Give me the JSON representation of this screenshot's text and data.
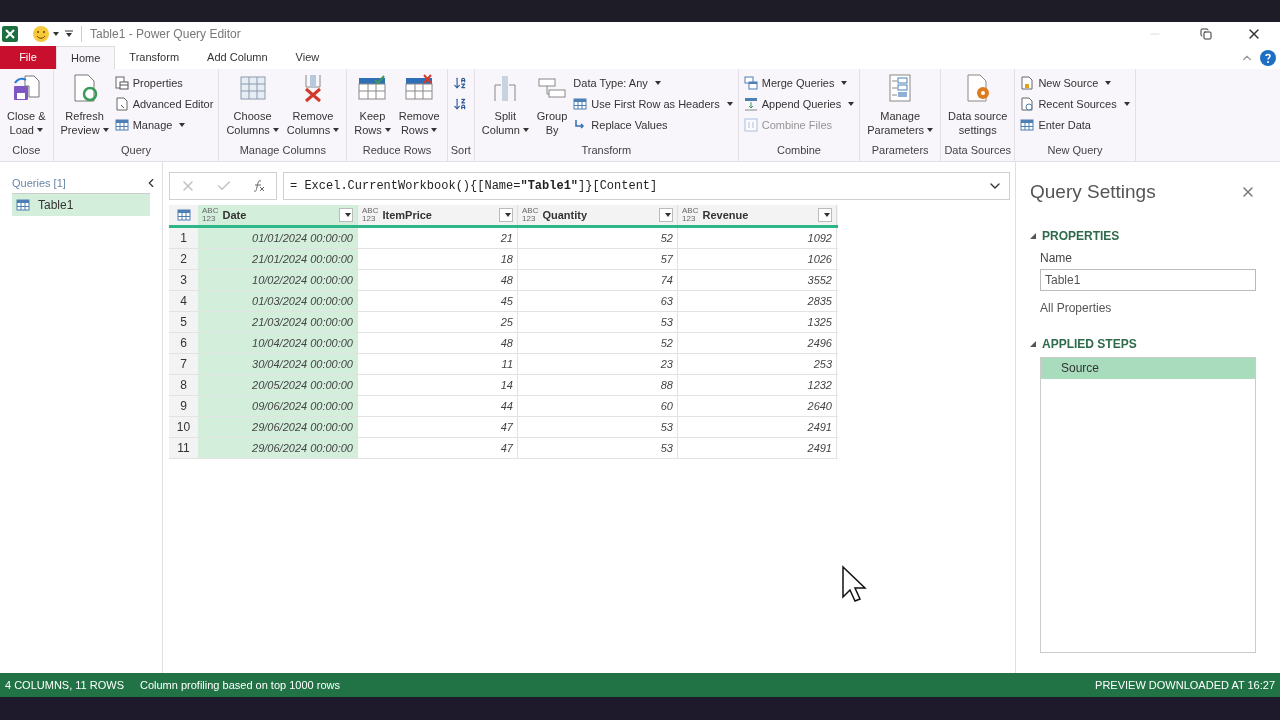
{
  "window": {
    "title": "Table1 - Power Query Editor"
  },
  "tabs": [
    {
      "label": "File",
      "kind": "file",
      "selected": false
    },
    {
      "label": "Home",
      "kind": "tab",
      "selected": true
    },
    {
      "label": "Transform",
      "kind": "tab",
      "selected": false
    },
    {
      "label": "Add Column",
      "kind": "tab",
      "selected": false
    },
    {
      "label": "View",
      "kind": "tab",
      "selected": false
    }
  ],
  "ribbon": {
    "groups": [
      {
        "label": "Close",
        "items": [
          {
            "kind": "large",
            "lines": [
              "Close &",
              "Load"
            ],
            "dropdown": true,
            "disabled": false
          }
        ]
      },
      {
        "label": "Query",
        "items": [
          {
            "kind": "large",
            "lines": [
              "Refresh",
              "Preview"
            ],
            "dropdown": true,
            "disabled": false
          },
          {
            "kind": "stack",
            "items": [
              {
                "label": "Properties",
                "dropdown": false,
                "disabled": false
              },
              {
                "label": "Advanced Editor",
                "dropdown": false,
                "disabled": false
              },
              {
                "label": "Manage",
                "dropdown": true,
                "disabled": false
              }
            ]
          }
        ]
      },
      {
        "label": "Manage Columns",
        "items": [
          {
            "kind": "large",
            "lines": [
              "Choose",
              "Columns"
            ],
            "dropdown": true,
            "disabled": false
          },
          {
            "kind": "large",
            "lines": [
              "Remove",
              "Columns"
            ],
            "dropdown": true,
            "disabled": false
          }
        ]
      },
      {
        "label": "Reduce Rows",
        "items": [
          {
            "kind": "large",
            "lines": [
              "Keep",
              "Rows"
            ],
            "dropdown": true,
            "disabled": false
          },
          {
            "kind": "large",
            "lines": [
              "Remove",
              "Rows"
            ],
            "dropdown": true,
            "disabled": false
          }
        ]
      },
      {
        "label": "Sort",
        "items": [
          {
            "kind": "stack",
            "items": [
              {
                "dropdown": false,
                "disabled": false
              },
              {
                "dropdown": false,
                "disabled": false
              }
            ]
          }
        ]
      },
      {
        "label": "Transform",
        "items": [
          {
            "kind": "large",
            "lines": [
              "Split",
              "Column"
            ],
            "dropdown": true,
            "disabled": false
          },
          {
            "kind": "large",
            "lines": [
              "Group",
              "By"
            ],
            "dropdown": false,
            "disabled": false
          },
          {
            "kind": "stack",
            "items": [
              {
                "label": "Data Type: Any",
                "dropdown": true,
                "disabled": false
              },
              {
                "label": "Use First Row as Headers",
                "dropdown": true,
                "disabled": false
              },
              {
                "label": "Replace Values",
                "dropdown": false,
                "disabled": false
              }
            ]
          }
        ]
      },
      {
        "label": "Combine",
        "items": [
          {
            "kind": "stack",
            "items": [
              {
                "label": "Merge Queries",
                "dropdown": true,
                "disabled": false
              },
              {
                "label": "Append Queries",
                "dropdown": true,
                "disabled": false
              },
              {
                "label": "Combine Files",
                "dropdown": false,
                "disabled": true
              }
            ]
          }
        ]
      },
      {
        "label": "Parameters",
        "items": [
          {
            "kind": "large",
            "lines": [
              "Manage",
              "Parameters"
            ],
            "dropdown": true,
            "disabled": false
          }
        ]
      },
      {
        "label": "Data Sources",
        "items": [
          {
            "kind": "large",
            "lines": [
              "Data source",
              "settings"
            ],
            "dropdown": false,
            "disabled": false
          }
        ]
      },
      {
        "label": "New Query",
        "items": [
          {
            "kind": "stack",
            "items": [
              {
                "label": "New Source",
                "dropdown": true,
                "disabled": false
              },
              {
                "label": "Recent Sources",
                "dropdown": true,
                "disabled": false
              },
              {
                "label": "Enter Data",
                "dropdown": false,
                "disabled": false
              }
            ]
          }
        ]
      }
    ]
  },
  "queries": {
    "heading": "Queries [1]",
    "items": [
      {
        "label": "Table1",
        "selected": true
      }
    ]
  },
  "formula": "= Excel.CurrentWorkbook(){[Name=**\"Table1\"**]}[Content]",
  "table": {
    "columns": [
      {
        "label": "Date",
        "type": [
          "ABC",
          "123"
        ],
        "selected": true
      },
      {
        "label": "ItemPrice",
        "type": [
          "ABC",
          "123"
        ],
        "selected": false
      },
      {
        "label": "Quantity",
        "type": [
          "ABC",
          "123"
        ],
        "selected": false
      },
      {
        "label": "Revenue",
        "type": [
          "ABC",
          "123"
        ],
        "selected": false
      }
    ],
    "rows": [
      [
        "1",
        "01/01/2024 00:00:00",
        "21",
        "52",
        "1092"
      ],
      [
        "2",
        "21/01/2024 00:00:00",
        "18",
        "57",
        "1026"
      ],
      [
        "3",
        "10/02/2024 00:00:00",
        "48",
        "74",
        "3552"
      ],
      [
        "4",
        "01/03/2024 00:00:00",
        "45",
        "63",
        "2835"
      ],
      [
        "5",
        "21/03/2024 00:00:00",
        "25",
        "53",
        "1325"
      ],
      [
        "6",
        "10/04/2024 00:00:00",
        "48",
        "52",
        "2496"
      ],
      [
        "7",
        "30/04/2024 00:00:00",
        "11",
        "23",
        "253"
      ],
      [
        "8",
        "20/05/2024 00:00:00",
        "14",
        "88",
        "1232"
      ],
      [
        "9",
        "09/06/2024 00:00:00",
        "44",
        "60",
        "2640"
      ],
      [
        "10",
        "29/06/2024 00:00:00",
        "47",
        "53",
        "2491"
      ],
      [
        "11",
        "29/06/2024 00:00:00",
        "47",
        "53",
        "2491"
      ]
    ]
  },
  "settings": {
    "title": "Query Settings",
    "properties_heading": "PROPERTIES",
    "name_label": "Name",
    "name_value": "Table1",
    "all_properties": "All Properties",
    "steps_heading": "APPLIED STEPS",
    "steps": [
      {
        "label": "Source",
        "selected": true
      }
    ]
  },
  "status_bar": {
    "left": [
      "4 COLUMNS, 11 ROWS",
      "Column profiling based on top 1000 rows"
    ],
    "right": "PREVIEW DOWNLOADED AT 16:27"
  }
}
